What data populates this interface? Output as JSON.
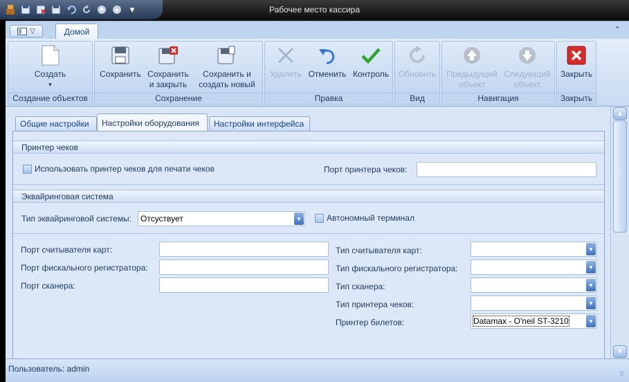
{
  "window": {
    "title": "Рабочее место кассира"
  },
  "ribbon": {
    "tab_home": "Домой",
    "groups": [
      {
        "label": "Создание объектов",
        "buttons": [
          {
            "label": "Создать",
            "icon": "new-document-icon",
            "dropdown": true
          }
        ]
      },
      {
        "label": "Сохранение",
        "buttons": [
          {
            "label": "Сохранить",
            "icon": "save-icon"
          },
          {
            "label": "Сохранить и закрыть",
            "icon": "save-close-icon"
          },
          {
            "label": "Сохранить и создать новый",
            "icon": "save-new-icon",
            "dropdown": true
          }
        ]
      },
      {
        "label": "Правка",
        "buttons": [
          {
            "label": "Удалить",
            "icon": "delete-icon",
            "disabled": true
          },
          {
            "label": "Отменить",
            "icon": "undo-icon"
          },
          {
            "label": "Контроль",
            "icon": "check-icon"
          }
        ]
      },
      {
        "label": "Вид",
        "buttons": [
          {
            "label": "Обновить",
            "icon": "refresh-icon",
            "disabled": true
          }
        ]
      },
      {
        "label": "Навигация",
        "buttons": [
          {
            "label": "Предыдущий объект",
            "icon": "arrow-up-icon",
            "disabled": true
          },
          {
            "label": "Следующий объект",
            "icon": "arrow-down-icon",
            "disabled": true
          }
        ]
      },
      {
        "label": "Закрыть",
        "buttons": [
          {
            "label": "Закрыть",
            "icon": "close-icon"
          }
        ]
      }
    ]
  },
  "tabs": [
    "Общие настройки",
    "Настройки оборудования",
    "Настройки интерфейса"
  ],
  "active_tab": 1,
  "printer_section": {
    "title": "Принтер чеков",
    "use_printer_label": "Использовать принтер чеков для печати чеков",
    "use_printer_checked": false,
    "port_label": "Порт принтера чеков:",
    "port_value": ""
  },
  "acquiring_section": {
    "title": "Эквайринговая система",
    "type_label": "Тип эквайринговой системы:",
    "type_value": "Отсуствует",
    "autonomous_label": "Автономный терминал",
    "autonomous_checked": false
  },
  "devices": {
    "left": [
      {
        "label": "Порт считывателя карт:",
        "value": ""
      },
      {
        "label": "Порт фискального регистратора:",
        "value": ""
      },
      {
        "label": "Порт сканера:",
        "value": ""
      }
    ],
    "right": [
      {
        "label": "Тип считывателя карт:",
        "value": ""
      },
      {
        "label": "Тип фискального регистратора:",
        "value": ""
      },
      {
        "label": "Тип сканера:",
        "value": ""
      },
      {
        "label": "Тип принтера чеков:",
        "value": ""
      },
      {
        "label": "Принтер билетов:",
        "value": "Datamax - O'neil ST-3210"
      }
    ]
  },
  "status": {
    "user": "Пользователь: admin"
  },
  "colors": {
    "accent": "#15428b",
    "ribbon_bg": "#c8daf1",
    "close_red": "#d52b2b",
    "check_green": "#2ea32e"
  }
}
